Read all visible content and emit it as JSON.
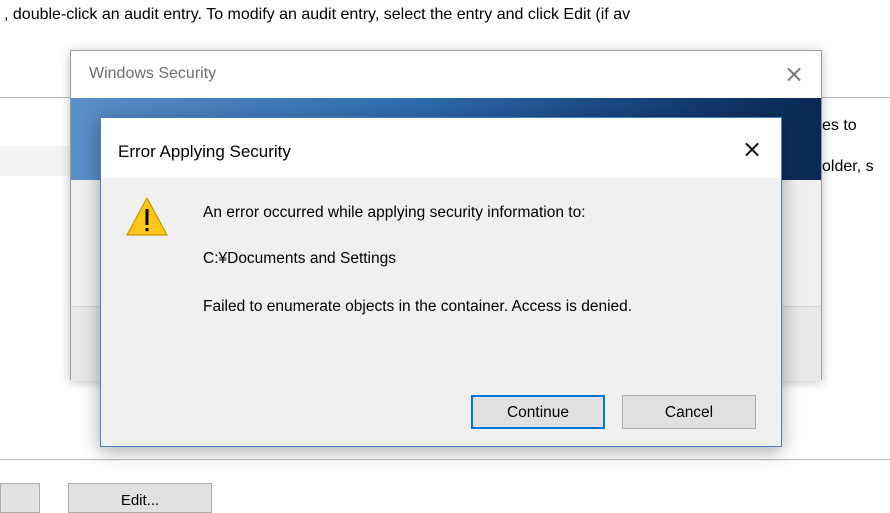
{
  "background": {
    "instruction_text": ", double-click an audit entry. To modify an audit entry, select the entry and click Edit (if av",
    "bottom_button_left": "",
    "bottom_button_edit": "Edit..."
  },
  "security_window": {
    "title": "Windows Security",
    "close_glyph": "×",
    "banner_line1": "es to",
    "banner_line2": "older, s"
  },
  "error_dialog": {
    "title": "Error Applying Security",
    "close_glyph": "×",
    "icon": "warning-icon",
    "message_line1": "An error occurred while applying security information to:",
    "message_line2": "C:¥Documents and Settings",
    "message_line3": "Failed to enumerate objects in the container. Access is denied.",
    "continue_label": "Continue",
    "cancel_label": "Cancel"
  },
  "colors": {
    "accent": "#0078d7",
    "warning": "#ffc61a",
    "banner_dark": "#0a2853"
  }
}
